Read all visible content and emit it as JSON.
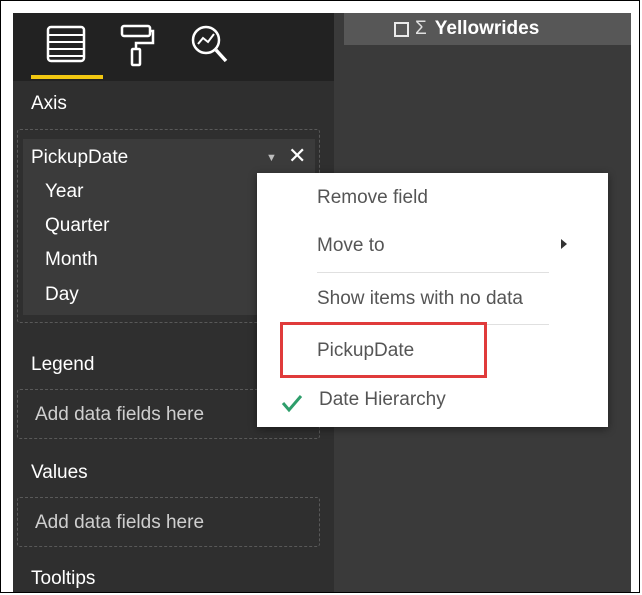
{
  "canvas": {
    "checkbox_icon": "checkbox-icon",
    "sigma_icon": "sigma",
    "table_name": "Yellowrides",
    "sigma_glyph": "Σ"
  },
  "panel": {
    "tabs": [
      {
        "icon": "fields-icon",
        "active": true
      },
      {
        "icon": "format-paint-roller-icon",
        "active": false
      },
      {
        "icon": "analytics-magnifier-icon",
        "active": false
      }
    ],
    "sections": {
      "axis": "Axis",
      "legend": "Legend",
      "values": "Values",
      "tooltips": "Tooltips"
    },
    "axis_field": {
      "name": "PickupDate",
      "hierarchy": [
        "Year",
        "Quarter",
        "Month",
        "Day"
      ]
    },
    "placeholder": "Add data fields here"
  },
  "context_menu": {
    "items": {
      "remove_field": "Remove field",
      "move_to": "Move to",
      "show_items_no_data": "Show items with no data",
      "pickup_date": "PickupDate",
      "date_hierarchy": "Date Hierarchy"
    },
    "checked": "Date Hierarchy",
    "highlighted": "PickupDate"
  },
  "colors": {
    "accent_tab": "#f2c811",
    "highlight_box": "#e03b3b",
    "checkmark": "#2e9e6b",
    "panel_bg": "#2f2f2f",
    "canvas_bg": "#3a3a3a"
  }
}
